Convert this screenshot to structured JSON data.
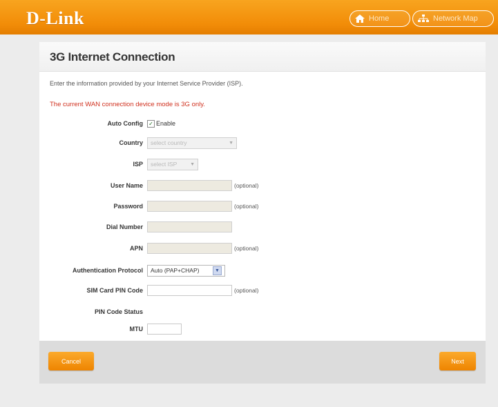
{
  "header": {
    "logo": "D-Link",
    "home_label": "Home",
    "map_label": "Network Map"
  },
  "page": {
    "title": "3G Internet Connection",
    "intro": "Enter the information provided by your Internet Service Provider (ISP).",
    "warning": "The current WAN connection device mode is 3G only."
  },
  "form": {
    "auto_config": {
      "label": "Auto Config",
      "checkbox_label": "Enable",
      "checked": true
    },
    "country": {
      "label": "Country",
      "value": "select country"
    },
    "isp": {
      "label": "ISP",
      "value": "select ISP"
    },
    "user_name": {
      "label": "User Name",
      "value": "",
      "note": "(optional)"
    },
    "password": {
      "label": "Password",
      "value": "",
      "note": "(optional)"
    },
    "dial_number": {
      "label": "Dial Number",
      "value": ""
    },
    "apn": {
      "label": "APN",
      "value": "",
      "note": "(optional)"
    },
    "auth_protocol": {
      "label": "Authentication Protocol",
      "value": "Auto (PAP+CHAP)"
    },
    "sim_pin": {
      "label": "SIM Card PIN Code",
      "value": "",
      "note": "(optional)"
    },
    "pin_status": {
      "label": "PIN Code Status",
      "value": ""
    },
    "mtu": {
      "label": "MTU",
      "value": ""
    }
  },
  "footer": {
    "cancel_label": "Cancel",
    "next_label": "Next"
  },
  "colors": {
    "brand_orange": "#f28d08",
    "warning_red": "#d0301e"
  },
  "icons": {
    "home": "home-icon",
    "map": "network-map-icon",
    "check": "checkmark-icon",
    "dropdown": "chevron-down-icon"
  }
}
